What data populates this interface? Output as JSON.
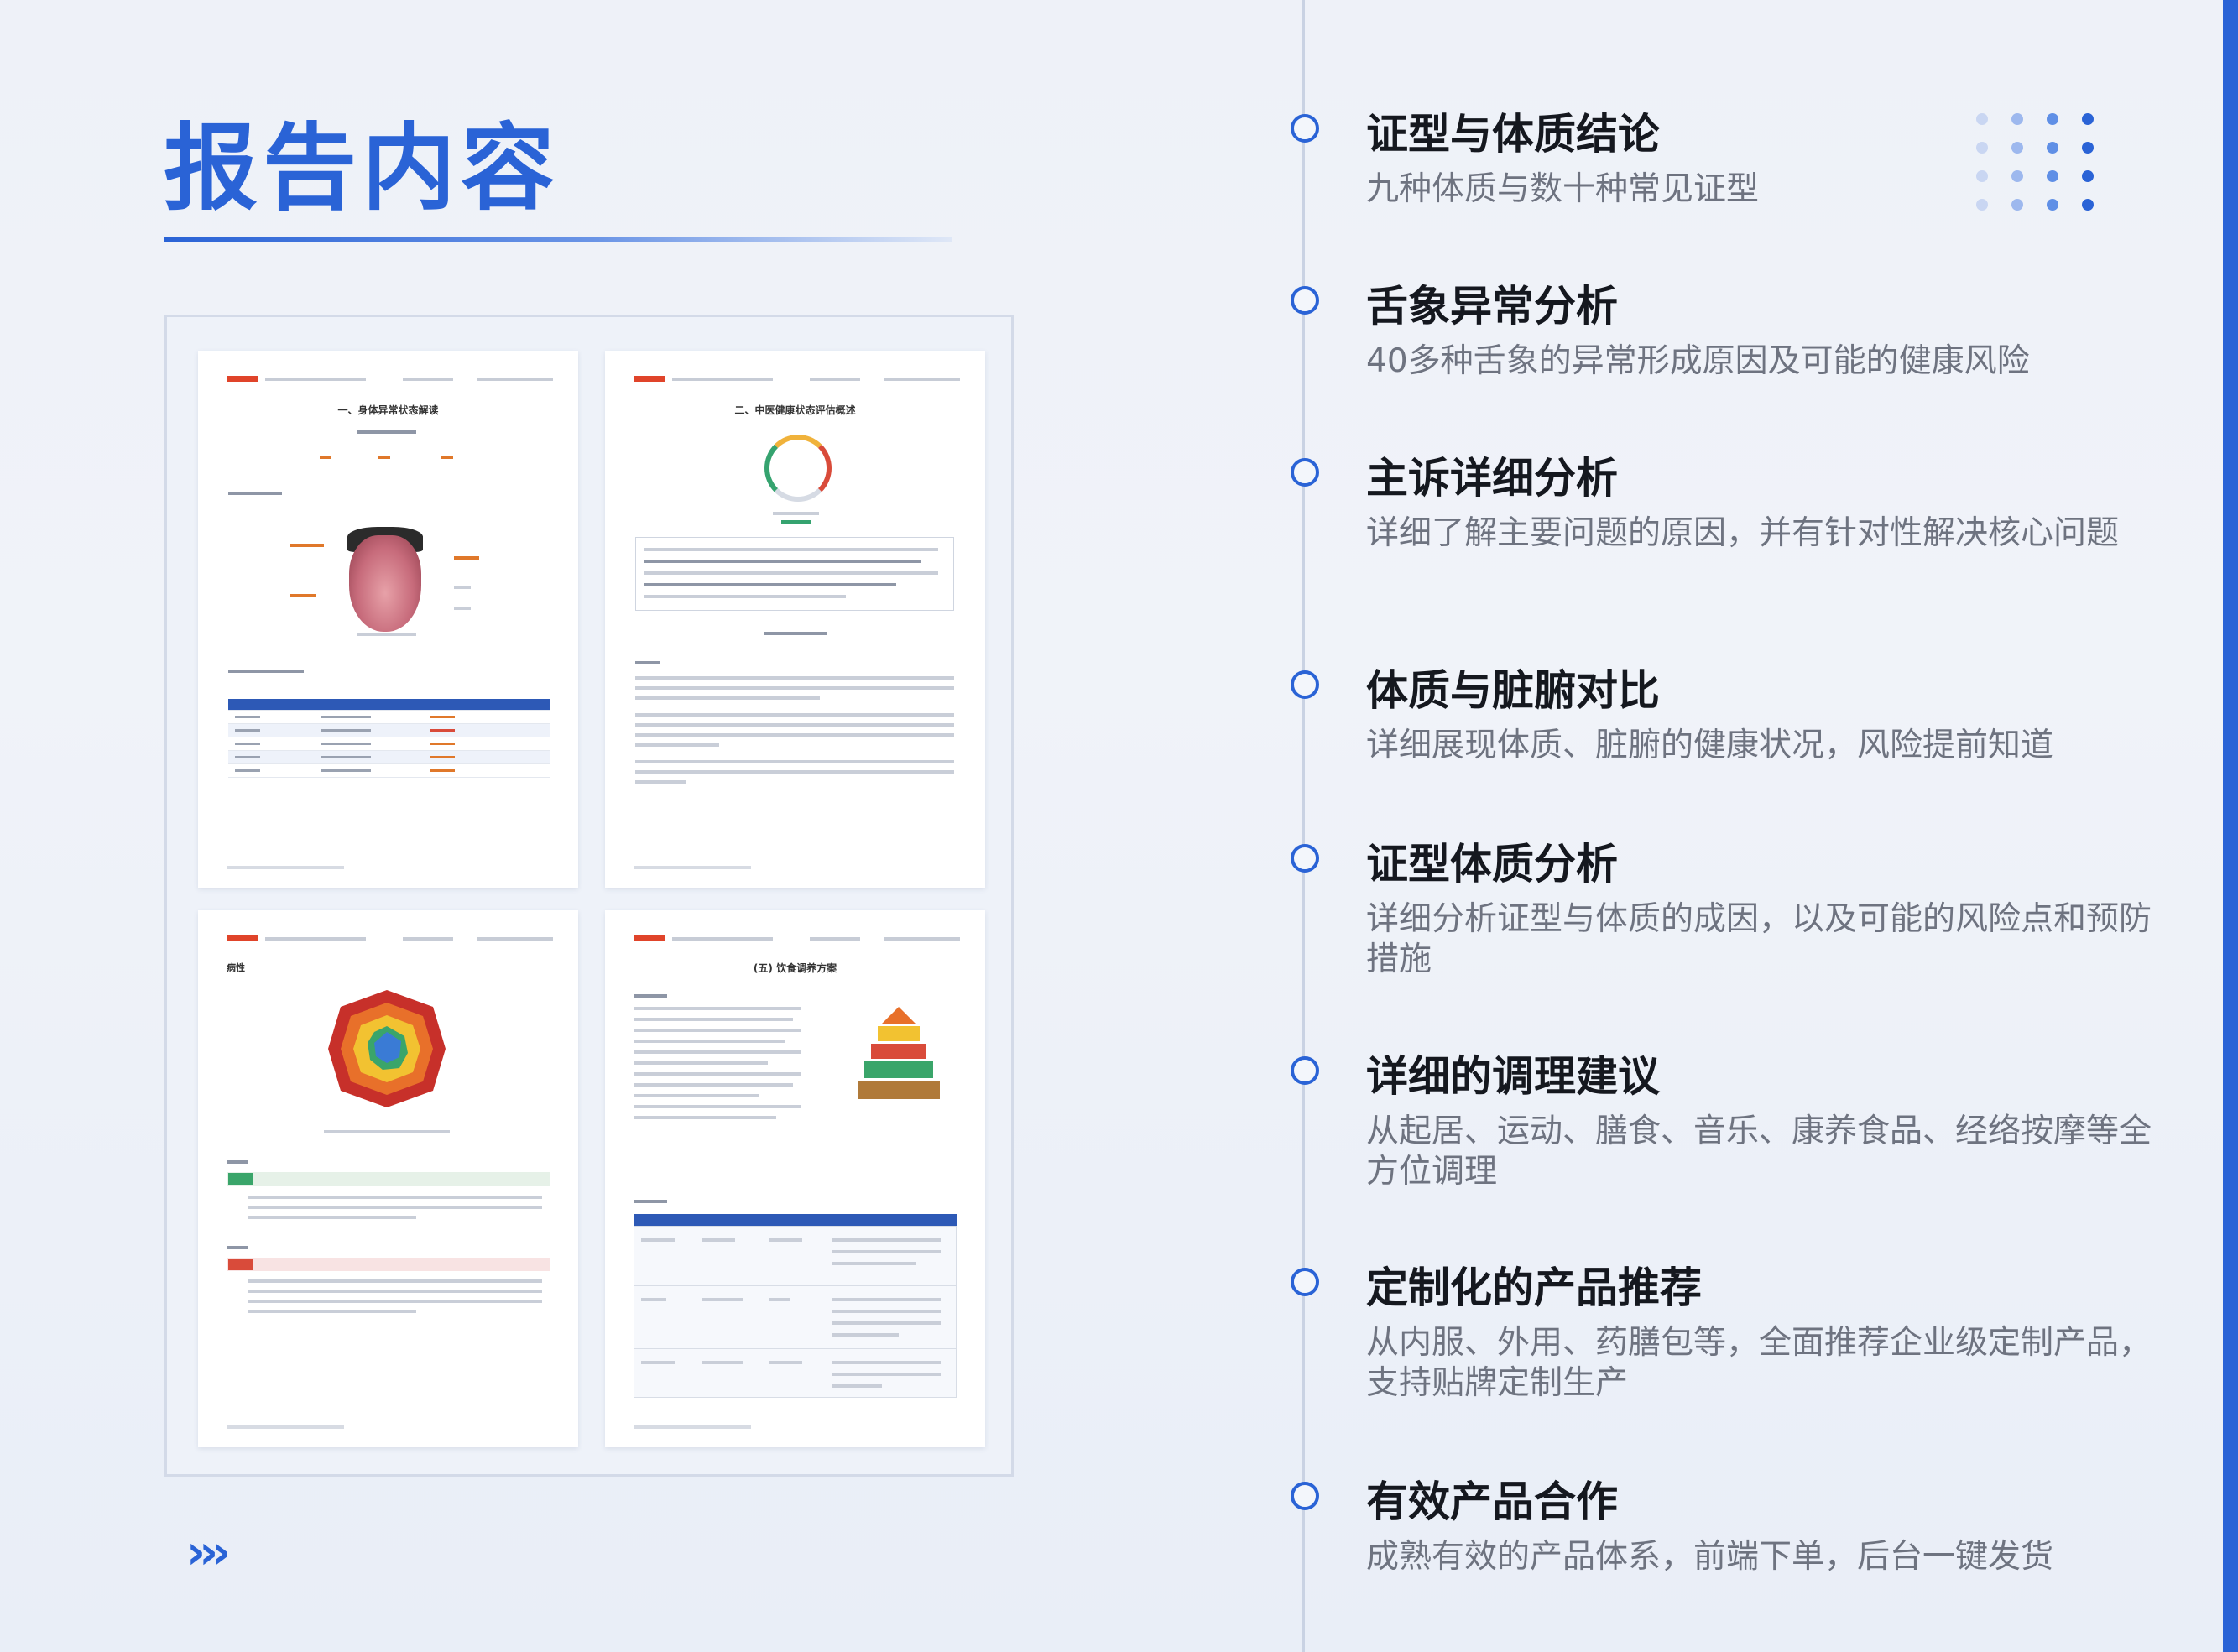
{
  "title": "报告内容",
  "timeline": [
    {
      "heading": "证型与体质结论",
      "desc": "九种体质与数十种常见证型"
    },
    {
      "heading": "舌象异常分析",
      "desc": "40多种舌象的异常形成原因及可能的健康风险"
    },
    {
      "heading": "主诉详细分析",
      "desc": "详细了解主要问题的原因，并有针对性解决核心问题"
    },
    {
      "heading": "体质与脏腑对比",
      "desc": "详细展现体质、脏腑的健康状况，风险提前知道"
    },
    {
      "heading": "证型体质分析",
      "desc": "详细分析证型与体质的成因，以及可能的风险点和预防措施"
    },
    {
      "heading": "详细的调理建议",
      "desc": "从起居、运动、膳食、音乐、康养食品、经络按摩等全方位调理"
    },
    {
      "heading": "定制化的产品推荐",
      "desc": "从内服、外用、药膳包等，全面推荐企业级定制产品，支持贴牌定制生产"
    },
    {
      "heading": "有效产品合作",
      "desc": "成熟有效的产品体系，前端下单，后台一键发货"
    }
  ],
  "preview_docs": [
    {
      "title": "一、身体异常状态解读"
    },
    {
      "title": "二、中医健康状态评估概述"
    },
    {
      "title": "病性"
    },
    {
      "title": "(五) 饮食调养方案"
    }
  ],
  "colors": {
    "accent": "#2a63d6",
    "heading": "#15181f",
    "desc": "#6e7380"
  },
  "icons": {
    "chevrons": "chevron-right-icon",
    "timeline_dot": "circle-outline-icon",
    "dot_grid": "dot-grid-decoration"
  }
}
